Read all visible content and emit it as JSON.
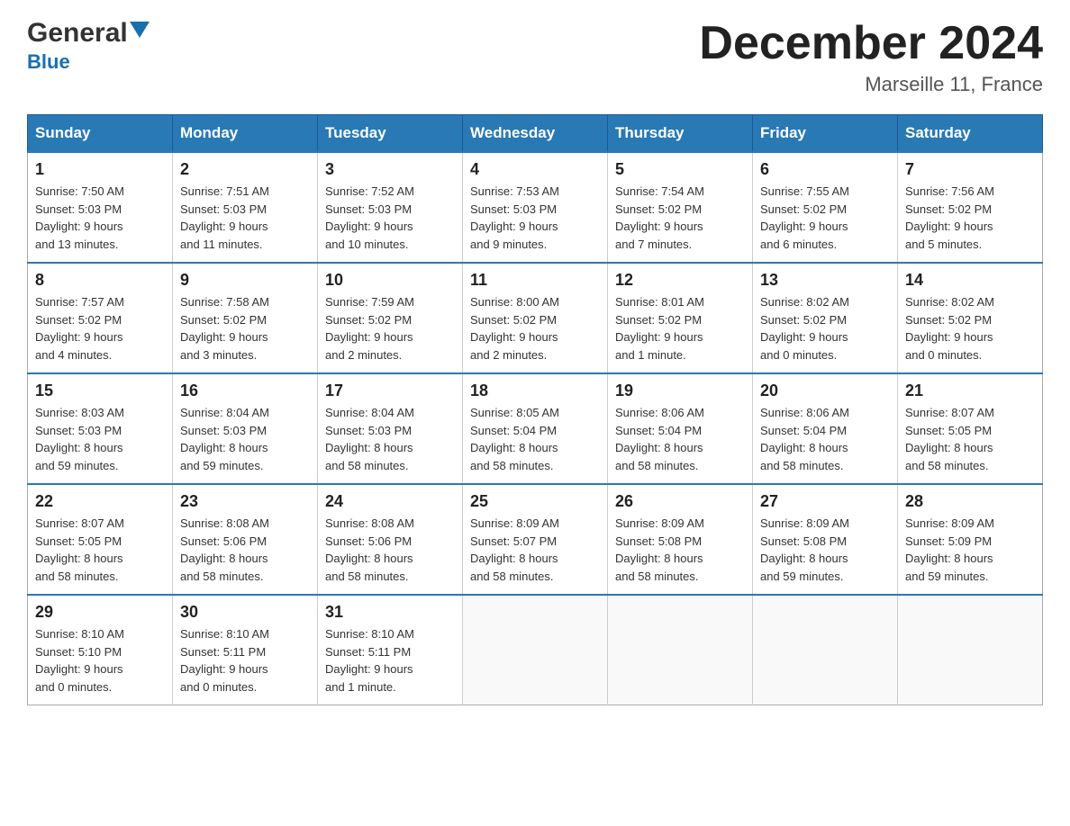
{
  "header": {
    "logo_general": "General",
    "logo_blue": "Blue",
    "month_title": "December 2024",
    "location": "Marseille 11, France"
  },
  "weekdays": [
    "Sunday",
    "Monday",
    "Tuesday",
    "Wednesday",
    "Thursday",
    "Friday",
    "Saturday"
  ],
  "weeks": [
    [
      {
        "day": "1",
        "sunrise": "7:50 AM",
        "sunset": "5:03 PM",
        "daylight": "9 hours and 13 minutes."
      },
      {
        "day": "2",
        "sunrise": "7:51 AM",
        "sunset": "5:03 PM",
        "daylight": "9 hours and 11 minutes."
      },
      {
        "day": "3",
        "sunrise": "7:52 AM",
        "sunset": "5:03 PM",
        "daylight": "9 hours and 10 minutes."
      },
      {
        "day": "4",
        "sunrise": "7:53 AM",
        "sunset": "5:03 PM",
        "daylight": "9 hours and 9 minutes."
      },
      {
        "day": "5",
        "sunrise": "7:54 AM",
        "sunset": "5:02 PM",
        "daylight": "9 hours and 7 minutes."
      },
      {
        "day": "6",
        "sunrise": "7:55 AM",
        "sunset": "5:02 PM",
        "daylight": "9 hours and 6 minutes."
      },
      {
        "day": "7",
        "sunrise": "7:56 AM",
        "sunset": "5:02 PM",
        "daylight": "9 hours and 5 minutes."
      }
    ],
    [
      {
        "day": "8",
        "sunrise": "7:57 AM",
        "sunset": "5:02 PM",
        "daylight": "9 hours and 4 minutes."
      },
      {
        "day": "9",
        "sunrise": "7:58 AM",
        "sunset": "5:02 PM",
        "daylight": "9 hours and 3 minutes."
      },
      {
        "day": "10",
        "sunrise": "7:59 AM",
        "sunset": "5:02 PM",
        "daylight": "9 hours and 2 minutes."
      },
      {
        "day": "11",
        "sunrise": "8:00 AM",
        "sunset": "5:02 PM",
        "daylight": "9 hours and 2 minutes."
      },
      {
        "day": "12",
        "sunrise": "8:01 AM",
        "sunset": "5:02 PM",
        "daylight": "9 hours and 1 minute."
      },
      {
        "day": "13",
        "sunrise": "8:02 AM",
        "sunset": "5:02 PM",
        "daylight": "9 hours and 0 minutes."
      },
      {
        "day": "14",
        "sunrise": "8:02 AM",
        "sunset": "5:02 PM",
        "daylight": "9 hours and 0 minutes."
      }
    ],
    [
      {
        "day": "15",
        "sunrise": "8:03 AM",
        "sunset": "5:03 PM",
        "daylight": "8 hours and 59 minutes."
      },
      {
        "day": "16",
        "sunrise": "8:04 AM",
        "sunset": "5:03 PM",
        "daylight": "8 hours and 59 minutes."
      },
      {
        "day": "17",
        "sunrise": "8:04 AM",
        "sunset": "5:03 PM",
        "daylight": "8 hours and 58 minutes."
      },
      {
        "day": "18",
        "sunrise": "8:05 AM",
        "sunset": "5:04 PM",
        "daylight": "8 hours and 58 minutes."
      },
      {
        "day": "19",
        "sunrise": "8:06 AM",
        "sunset": "5:04 PM",
        "daylight": "8 hours and 58 minutes."
      },
      {
        "day": "20",
        "sunrise": "8:06 AM",
        "sunset": "5:04 PM",
        "daylight": "8 hours and 58 minutes."
      },
      {
        "day": "21",
        "sunrise": "8:07 AM",
        "sunset": "5:05 PM",
        "daylight": "8 hours and 58 minutes."
      }
    ],
    [
      {
        "day": "22",
        "sunrise": "8:07 AM",
        "sunset": "5:05 PM",
        "daylight": "8 hours and 58 minutes."
      },
      {
        "day": "23",
        "sunrise": "8:08 AM",
        "sunset": "5:06 PM",
        "daylight": "8 hours and 58 minutes."
      },
      {
        "day": "24",
        "sunrise": "8:08 AM",
        "sunset": "5:06 PM",
        "daylight": "8 hours and 58 minutes."
      },
      {
        "day": "25",
        "sunrise": "8:09 AM",
        "sunset": "5:07 PM",
        "daylight": "8 hours and 58 minutes."
      },
      {
        "day": "26",
        "sunrise": "8:09 AM",
        "sunset": "5:08 PM",
        "daylight": "8 hours and 58 minutes."
      },
      {
        "day": "27",
        "sunrise": "8:09 AM",
        "sunset": "5:08 PM",
        "daylight": "8 hours and 59 minutes."
      },
      {
        "day": "28",
        "sunrise": "8:09 AM",
        "sunset": "5:09 PM",
        "daylight": "8 hours and 59 minutes."
      }
    ],
    [
      {
        "day": "29",
        "sunrise": "8:10 AM",
        "sunset": "5:10 PM",
        "daylight": "9 hours and 0 minutes."
      },
      {
        "day": "30",
        "sunrise": "8:10 AM",
        "sunset": "5:11 PM",
        "daylight": "9 hours and 0 minutes."
      },
      {
        "day": "31",
        "sunrise": "8:10 AM",
        "sunset": "5:11 PM",
        "daylight": "9 hours and 1 minute."
      },
      null,
      null,
      null,
      null
    ]
  ],
  "labels": {
    "sunrise": "Sunrise:",
    "sunset": "Sunset:",
    "daylight": "Daylight:"
  }
}
